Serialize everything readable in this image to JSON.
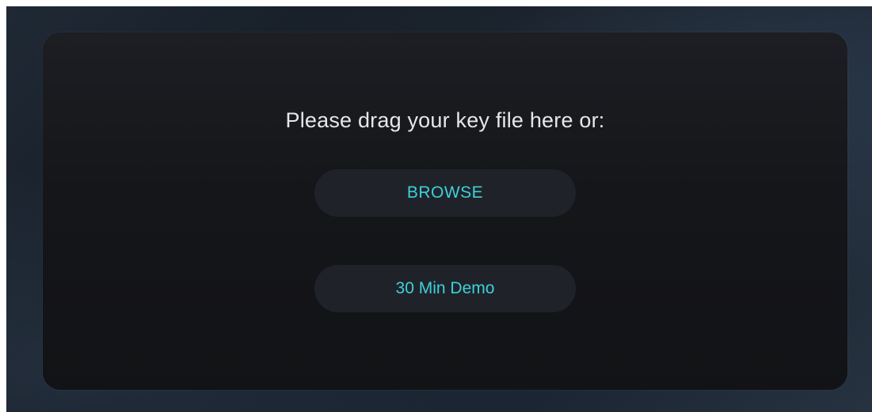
{
  "dialog": {
    "prompt": "Please drag your key file here or:",
    "browse_label": "BROWSE",
    "demo_label": "30 Min Demo"
  },
  "colors": {
    "accent": "#3fd0da",
    "panel_bg": "#151619",
    "button_bg": "#1f2329",
    "text": "#e6e7ea"
  }
}
